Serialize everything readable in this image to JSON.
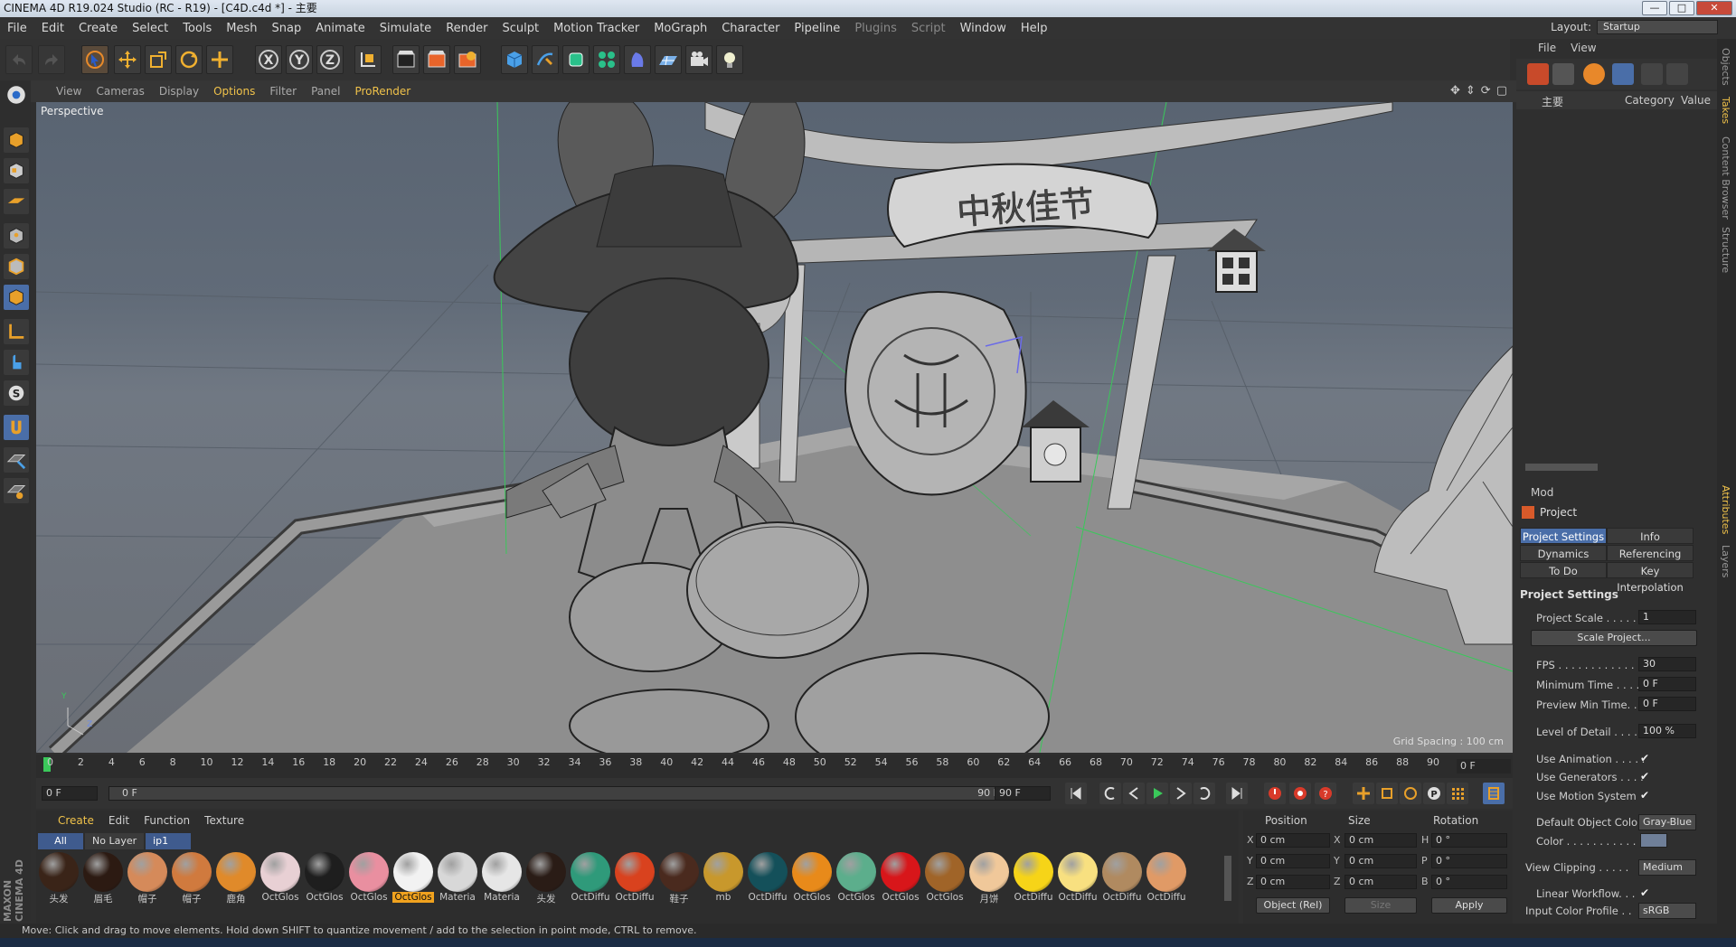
{
  "window": {
    "title": "CINEMA 4D R19.024 Studio (RC - R19) - [C4D.c4d *] - 主要",
    "controls": [
      "—",
      "□",
      "✕"
    ]
  },
  "menubar": {
    "items": [
      "File",
      "Edit",
      "Create",
      "Select",
      "Tools",
      "Mesh",
      "Snap",
      "Animate",
      "Simulate",
      "Render",
      "Sculpt",
      "Motion Tracker",
      "MoGraph",
      "Character",
      "Pipeline",
      "Plugins",
      "Script",
      "Window",
      "Help"
    ],
    "layout_label": "Layout:",
    "layout_value": "Startup"
  },
  "toolbar": {
    "icons": [
      "undo-icon",
      "redo-icon",
      "live-selection-icon",
      "move-icon",
      "scale-icon",
      "rotate-icon",
      "recent-tool-icon",
      "x-axis-icon",
      "y-axis-icon",
      "z-axis-icon",
      "coordinate-system-icon",
      "render-view-icon",
      "render-picture-viewer-icon",
      "edit-render-settings-icon",
      "cube-icon",
      "pen-icon",
      "subdivision-icon",
      "cloner-icon",
      "deformer-icon",
      "floor-icon",
      "camera-icon",
      "light-icon"
    ],
    "axis_labels": [
      "X",
      "Y",
      "Z"
    ]
  },
  "viewport": {
    "menu": [
      "View",
      "Cameras",
      "Display",
      "Options",
      "Filter",
      "Panel",
      "ProRender"
    ],
    "active_menu": "Options",
    "camera_label": "Perspective",
    "grid_spacing": "Grid Spacing : 100 cm",
    "sign_text": "中秋佳节",
    "axis": {
      "y": "Y",
      "z": "Z"
    }
  },
  "timeline": {
    "ticks": [
      "0",
      "2",
      "4",
      "6",
      "8",
      "10",
      "12",
      "14",
      "16",
      "18",
      "20",
      "22",
      "24",
      "26",
      "28",
      "30",
      "32",
      "34",
      "36",
      "38",
      "40",
      "42",
      "44",
      "46",
      "48",
      "50",
      "52",
      "54",
      "56",
      "58",
      "60",
      "62",
      "64",
      "66",
      "68",
      "70",
      "72",
      "74",
      "76",
      "78",
      "80",
      "82",
      "84",
      "86",
      "88",
      "90"
    ],
    "current_frame": "0 F"
  },
  "transport": {
    "start": "0 F",
    "range_start": "0 F",
    "range_end": "90 F",
    "end": "90 F"
  },
  "materials": {
    "menu": [
      "Create",
      "Edit",
      "Function",
      "Texture"
    ],
    "active_menu": "Create",
    "tabs": [
      "All",
      "No Layer",
      "ip1"
    ],
    "items": [
      {
        "label": "头发",
        "color": "#3a2418"
      },
      {
        "label": "眉毛",
        "color": "#2c1a12"
      },
      {
        "label": "帽子",
        "color": "#d58a5a"
      },
      {
        "label": "帽子",
        "color": "#d07a3e"
      },
      {
        "label": "鹿角",
        "color": "#e08a2a"
      },
      {
        "label": "OctGlos",
        "color": "#e8d0d4"
      },
      {
        "label": "OctGlos",
        "color": "#1e1e1e"
      },
      {
        "label": "OctGlos",
        "color": "#e98fa0"
      },
      {
        "label": "OctGlos",
        "color": "#f2f2f2",
        "selected": true
      },
      {
        "label": "Materia",
        "color": "#d8d8d8"
      },
      {
        "label": "Materia",
        "color": "#e6e6e6"
      },
      {
        "label": "头发",
        "color": "#2a1c16"
      },
      {
        "label": "OctDiffu",
        "color": "#2f9a7a"
      },
      {
        "label": "OctDiffu",
        "color": "#d9421e"
      },
      {
        "label": "鞋子",
        "color": "#4a2a1e"
      },
      {
        "label": "mb",
        "color": "#c8982c"
      },
      {
        "label": "OctDiffu",
        "color": "#14505a"
      },
      {
        "label": "OctGlos",
        "color": "#e88a1a"
      },
      {
        "label": "OctGlos",
        "color": "#5cae8c"
      },
      {
        "label": "OctGlos",
        "color": "#d8161a"
      },
      {
        "label": "OctGlos",
        "color": "#a06428"
      },
      {
        "label": "月饼",
        "color": "#f0c89a"
      },
      {
        "label": "OctDiffu",
        "color": "#f6d418"
      },
      {
        "label": "OctDiffu",
        "color": "#f8e080"
      },
      {
        "label": "OctDiffu",
        "color": "#b08a60"
      },
      {
        "label": "OctDiffu",
        "color": "#e09a66"
      }
    ]
  },
  "coordinates": {
    "headers": [
      "Position",
      "Size",
      "Rotation"
    ],
    "rows": [
      {
        "axis": "X",
        "pos": "0 cm",
        "size_axis": "X",
        "size": "0 cm",
        "rot_axis": "H",
        "rot": "0 °"
      },
      {
        "axis": "Y",
        "pos": "0 cm",
        "size_axis": "Y",
        "size": "0 cm",
        "rot_axis": "P",
        "rot": "0 °"
      },
      {
        "axis": "Z",
        "pos": "0 cm",
        "size_axis": "Z",
        "size": "0 cm",
        "rot_axis": "B",
        "rot": "0 °"
      }
    ],
    "mode": "Object (Rel)",
    "size_mode": "Size",
    "apply": "Apply"
  },
  "object_manager": {
    "menu": [
      "File",
      "View"
    ],
    "columns": {
      "name": "主要",
      "category": "Category",
      "value": "Value"
    }
  },
  "attributes": {
    "menu": "Mod",
    "title": "Project",
    "tabs": [
      {
        "label": "Project Settings",
        "active": true
      },
      {
        "label": "Info"
      },
      {
        "label": "Dynamics"
      },
      {
        "label": "Referencing"
      },
      {
        "label": "To Do"
      },
      {
        "label": "Key Interpolation"
      }
    ],
    "section": "Project Settings",
    "project_scale_label": "Project Scale . . . . . .",
    "project_scale": "1",
    "scale_project_btn": "Scale Project...",
    "fps_label": "FPS . . . . . . . . . . . . . .",
    "fps": "30",
    "min_time_label": "Minimum Time . . . .",
    "min_time": "0 F",
    "preview_min_label": "Preview Min Time. .",
    "preview_min": "0 F",
    "lod_label": "Level of Detail . . . . .",
    "lod": "100 %",
    "use_animation_label": "Use Animation . . . . .",
    "use_generators_label": "Use Generators . . . .",
    "use_motion_label": "Use Motion System",
    "check": "✔",
    "default_color_label": "Default Object Color",
    "default_color": "Gray-Blue",
    "color_label": "Color . . . . . . . . . . . .",
    "color_swatch": "#6f7f98",
    "view_clipping_label": "View Clipping . . . . .",
    "view_clipping": "Medium",
    "linear_workflow_label": "Linear Workflow. . .",
    "input_profile_label": "Input Color Profile . .",
    "input_profile": "sRGB"
  },
  "side_tabs": [
    "Objects",
    "Takes",
    "Content Browser",
    "Structure",
    "Attributes",
    "Layers"
  ],
  "status": "Move: Click and drag to move elements. Hold down SHIFT to quantize movement / add to the selection in point mode, CTRL to remove.",
  "brand": "MAXON CINEMA 4D"
}
